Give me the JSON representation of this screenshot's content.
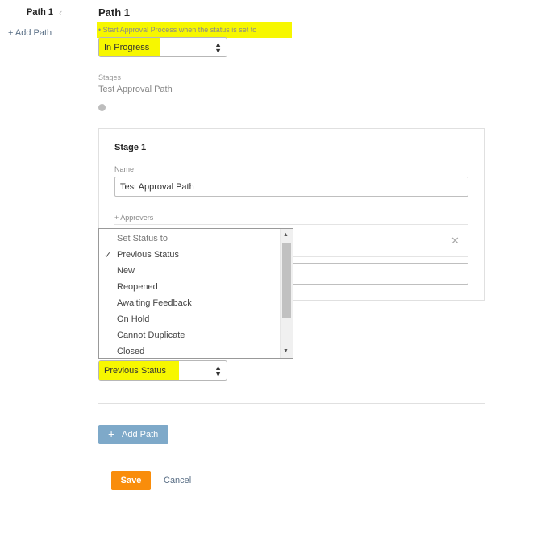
{
  "nav": {
    "path_label": "Path 1",
    "add_path_label": "+ Add Path"
  },
  "main": {
    "title": "Path 1",
    "trigger_hint": "• Start Approval Process when the status is set to",
    "trigger_value": "In Progress",
    "stages_label": "Stages",
    "stages_value": "Test Approval Path"
  },
  "stage": {
    "title": "Stage 1",
    "name_label": "Name",
    "name_value": "Test Approval Path",
    "approvers_label": "+ Approvers"
  },
  "dropdown": {
    "items": [
      {
        "label": "Set Status to",
        "checked": false
      },
      {
        "label": "Previous Status",
        "checked": true
      },
      {
        "label": "New",
        "checked": false
      },
      {
        "label": "Reopened",
        "checked": false
      },
      {
        "label": "Awaiting Feedback",
        "checked": false
      },
      {
        "label": "On Hold",
        "checked": false
      },
      {
        "label": "Cannot Duplicate",
        "checked": false
      },
      {
        "label": "Closed",
        "checked": false
      }
    ],
    "check_glyph": "✓"
  },
  "status_select": {
    "value": "Previous Status"
  },
  "buttons": {
    "add_path": "Add Path",
    "save": "Save",
    "cancel": "Cancel"
  },
  "colors": {
    "highlight": "#f7f700",
    "save": "#f98d0b",
    "add_path": "#7ea9c9",
    "link": "#5a6f86"
  }
}
